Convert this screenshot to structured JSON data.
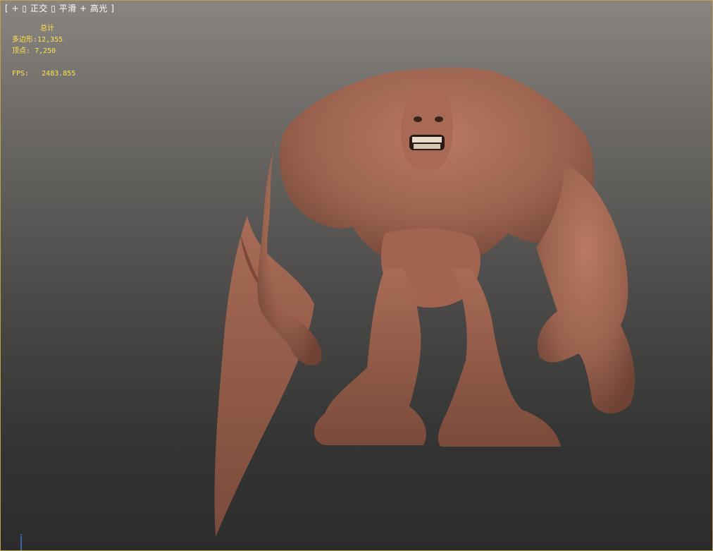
{
  "viewport": {
    "label_open": "[",
    "label_plus": "+",
    "label_box1": "▯",
    "view_mode": "正交",
    "label_box2": "▯",
    "shading_mode": "平滑",
    "label_plus2": "+",
    "highlight_mode": "高光",
    "label_close": "]"
  },
  "stats": {
    "total_label": "总计",
    "polygons_label": "多边形:",
    "polygons_value": "12,355",
    "vertices_label": "顶点:",
    "vertices_value": "7,250",
    "fps_label": "FPS:",
    "fps_value": "2483.855"
  },
  "axis": {
    "z_label": "z"
  },
  "colors": {
    "stats_text": "#ffe34a",
    "model_skin": "#a66a55",
    "viewport_border": "#b8a24a"
  }
}
